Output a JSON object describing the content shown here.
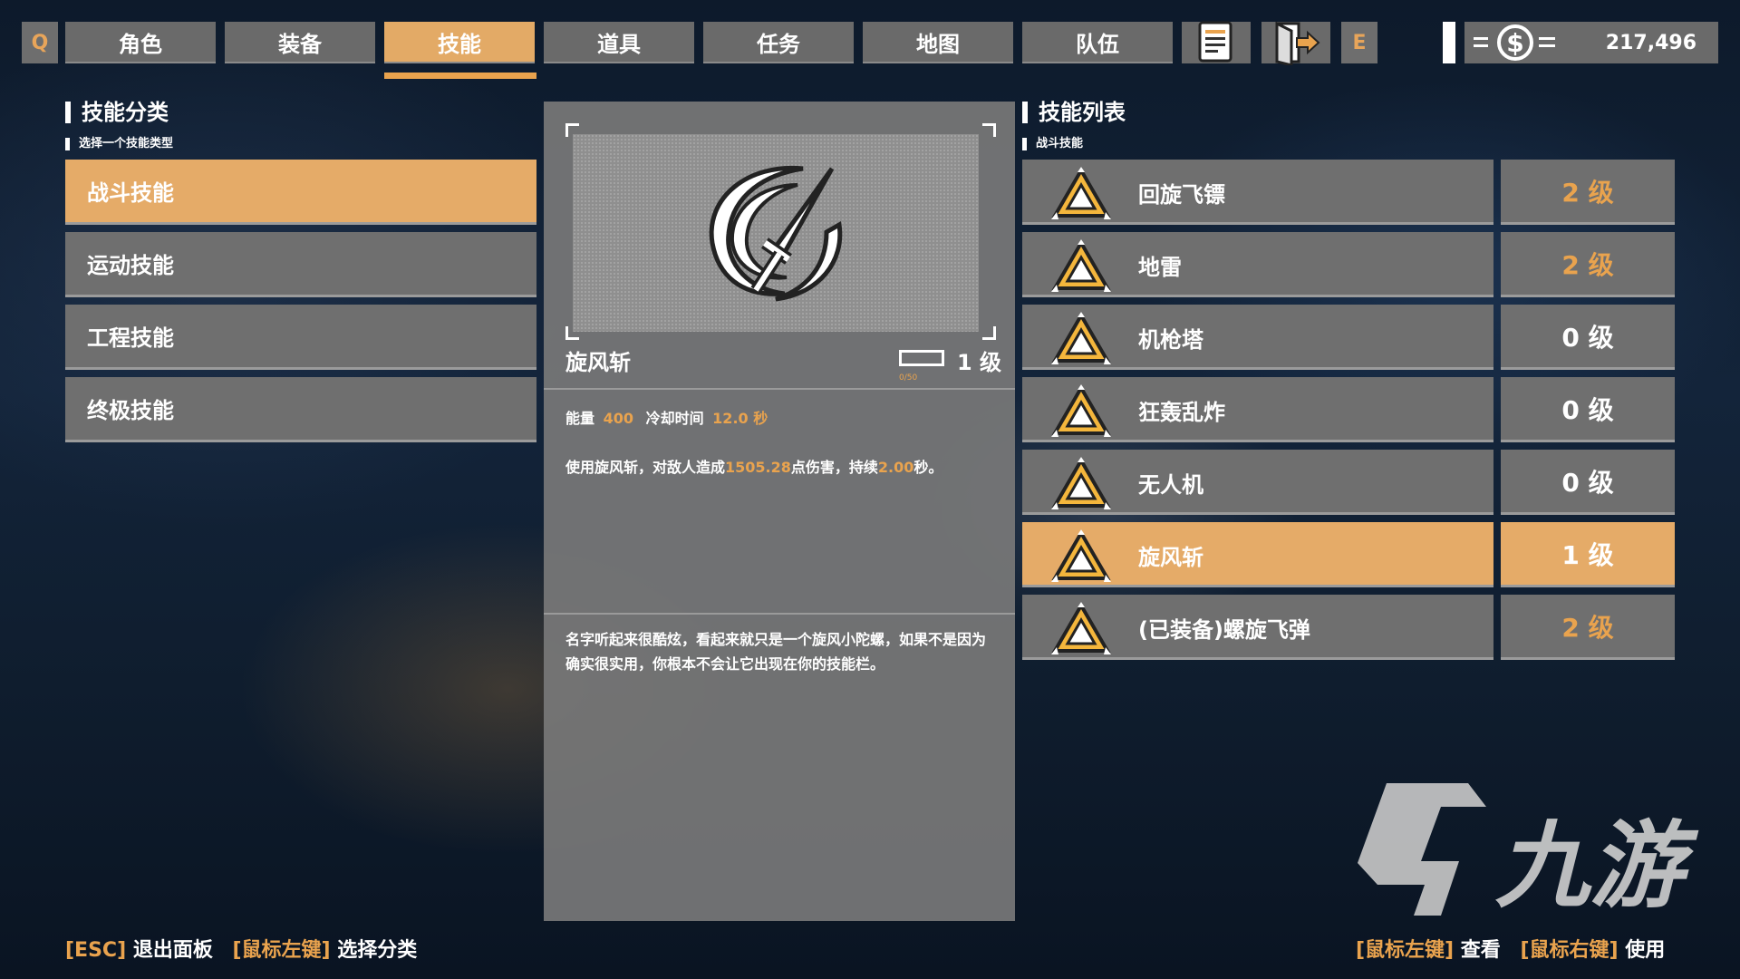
{
  "nav": {
    "key_left": "Q",
    "key_right": "E",
    "tabs": [
      {
        "label": "角色"
      },
      {
        "label": "装备"
      },
      {
        "label": "技能"
      },
      {
        "label": "道具"
      },
      {
        "label": "任务"
      },
      {
        "label": "地图"
      },
      {
        "label": "队伍"
      }
    ],
    "active_tab": "技能",
    "currency": "217,496"
  },
  "category": {
    "title": "技能分类",
    "subtitle": "选择一个技能类型",
    "items": [
      {
        "label": "战斗技能"
      },
      {
        "label": "运动技能"
      },
      {
        "label": "工程技能"
      },
      {
        "label": "终极技能"
      }
    ],
    "active": "战斗技能"
  },
  "detail": {
    "name": "旋风斩",
    "level": "1 级",
    "exp": "0/50",
    "energy_label": "能量",
    "energy_value": "400",
    "cooldown_label": "冷却时间",
    "cooldown_value": "12.0 秒",
    "desc_prefix": "使用旋风斩，对敌人造成",
    "desc_damage": "1505.28",
    "desc_mid": "点伤害，持续",
    "desc_duration": "2.00",
    "desc_suffix": "秒。",
    "flavor": "名字听起来很酷炫，看起来就只是一个旋风小陀螺，如果不是因为确实很实用，你根本不会让它出现在你的技能栏。"
  },
  "skill_list": {
    "title": "技能列表",
    "subtitle": "战斗技能",
    "items": [
      {
        "name": "回旋飞镖",
        "level": "2 级"
      },
      {
        "name": "地雷",
        "level": "2 级"
      },
      {
        "name": "机枪塔",
        "level": "0 级"
      },
      {
        "name": "狂轰乱炸",
        "level": "0 级"
      },
      {
        "name": "无人机",
        "level": "0 级"
      },
      {
        "name": "旋风斩",
        "level": "1 级"
      },
      {
        "name": "(已装备)螺旋飞弹",
        "level": "2 级"
      }
    ],
    "active": "旋风斩"
  },
  "hints": {
    "esc_key": "[ESC]",
    "esc_label": "退出面板",
    "left_key": "[鼠标左键]",
    "left_label": "选择分类",
    "view_key": "[鼠标左键]",
    "view_label": "查看",
    "right_key": "[鼠标右键]",
    "right_label": "使用"
  },
  "watermark": "九游",
  "colors": {
    "accent": "#e5ab68",
    "highlight_text": "#e9a34e",
    "panel": "#6f6f6f"
  }
}
